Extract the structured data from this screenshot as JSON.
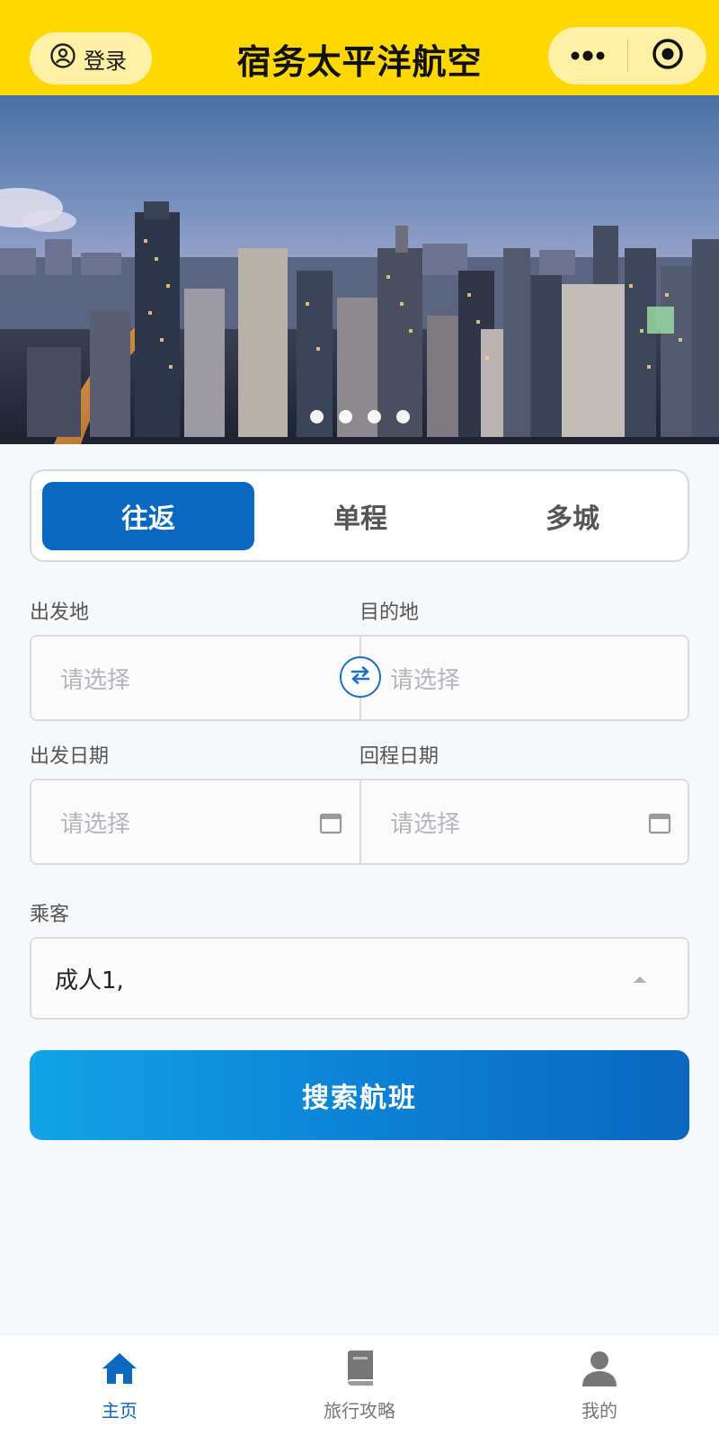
{
  "header": {
    "login_label": "登录",
    "title": "宿务太平洋航空"
  },
  "banner": {
    "slide_count": 4,
    "active_slide": 1
  },
  "trip_tabs": [
    {
      "label": "往返",
      "active": true
    },
    {
      "label": "单程",
      "active": false
    },
    {
      "label": "多城",
      "active": false
    }
  ],
  "form": {
    "origin": {
      "label": "出发地",
      "placeholder": "请选择"
    },
    "destination": {
      "label": "目的地",
      "placeholder": "请选择"
    },
    "depart_date": {
      "label": "出发日期",
      "placeholder": "请选择"
    },
    "return_date": {
      "label": "回程日期",
      "placeholder": "请选择"
    },
    "passengers": {
      "label": "乘客",
      "value": "成人1,"
    },
    "search_label": "搜索航班"
  },
  "bottom_nav": [
    {
      "label": "主页",
      "icon": "home-icon",
      "active": true
    },
    {
      "label": "旅行攻略",
      "icon": "book-icon",
      "active": false
    },
    {
      "label": "我的",
      "icon": "user-icon",
      "active": false
    }
  ],
  "colors": {
    "brand_yellow": "#ffd800",
    "primary_blue": "#0a68c0",
    "button_gradient_start": "#12a3e6"
  }
}
